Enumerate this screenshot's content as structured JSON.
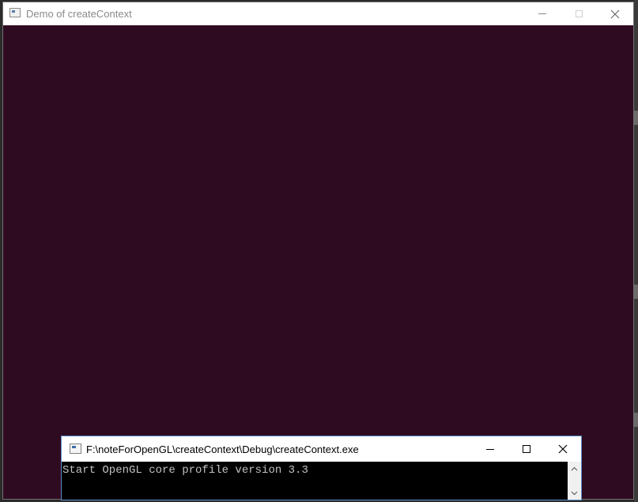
{
  "gl_window": {
    "title": "Demo of createContext",
    "client_color": "#2f0b22"
  },
  "console": {
    "title": "F:\\noteForOpenGL\\createContext\\Debug\\createContext.exe",
    "output": "Start OpenGL core profile version 3.3",
    "accent_border": "#5d8fc7"
  },
  "icons": {
    "app_icon": "window-app-icon",
    "minimize": "minimize-icon",
    "maximize": "maximize-icon",
    "close": "close-icon",
    "scroll_up": "chevron-up-icon",
    "scroll_down": "chevron-down-icon"
  }
}
